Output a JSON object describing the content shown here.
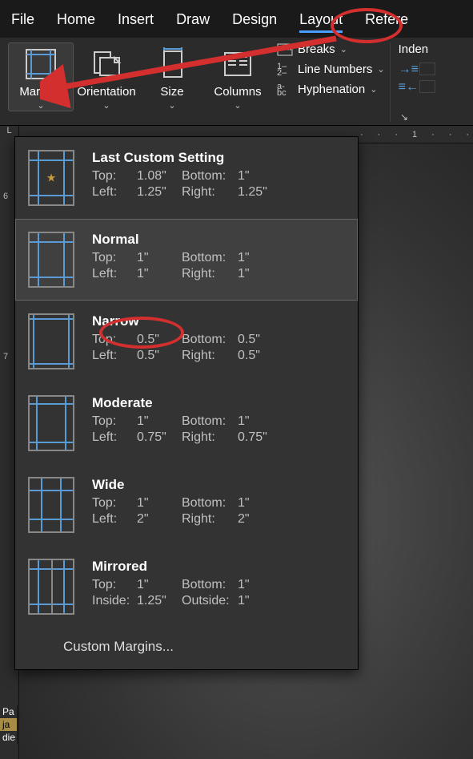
{
  "tabs": {
    "file": "File",
    "home": "Home",
    "insert": "Insert",
    "draw": "Draw",
    "design": "Design",
    "layout": "Layout",
    "references": "Refere"
  },
  "ribbon": {
    "margins": "Margins",
    "orientation": "Orientation",
    "size": "Size",
    "columns": "Columns",
    "breaks": "Breaks",
    "line_numbers": "Line Numbers",
    "hyphenation": "Hyphenation",
    "indent": "Inden"
  },
  "ruler_h": [
    "·",
    "·",
    "·",
    "1",
    "·",
    "·",
    "·"
  ],
  "vruler": {
    "six": "6",
    "seven": "7"
  },
  "leftbar": {
    "l": "L",
    "pa": "Pa",
    "ja": "ja",
    "die": "die"
  },
  "margins_menu": {
    "items": [
      {
        "name": "Last Custom Setting",
        "tl": "Top:",
        "tv": "1.08\"",
        "bl": "Bottom:",
        "bv": "1\"",
        "ll": "Left:",
        "lv": "1.25\"",
        "rl": "Right:",
        "rv": "1.25\"",
        "star": true
      },
      {
        "name": "Normal",
        "tl": "Top:",
        "tv": "1\"",
        "bl": "Bottom:",
        "bv": "1\"",
        "ll": "Left:",
        "lv": "1\"",
        "rl": "Right:",
        "rv": "1\"",
        "hovered": true
      },
      {
        "name": "Narrow",
        "tl": "Top:",
        "tv": "0.5\"",
        "bl": "Bottom:",
        "bv": "0.5\"",
        "ll": "Left:",
        "lv": "0.5\"",
        "rl": "Right:",
        "rv": "0.5\"",
        "circled": true
      },
      {
        "name": "Moderate",
        "tl": "Top:",
        "tv": "1\"",
        "bl": "Bottom:",
        "bv": "1\"",
        "ll": "Left:",
        "lv": "0.75\"",
        "rl": "Right:",
        "rv": "0.75\""
      },
      {
        "name": "Wide",
        "tl": "Top:",
        "tv": "1\"",
        "bl": "Bottom:",
        "bv": "1\"",
        "ll": "Left:",
        "lv": "2\"",
        "rl": "Right:",
        "rv": "2\""
      },
      {
        "name": "Mirrored",
        "tl": "Top:",
        "tv": "1\"",
        "bl": "Bottom:",
        "bv": "1\"",
        "ll": "Inside:",
        "lv": "1.25\"",
        "rl": "Outside:",
        "rv": "1\"",
        "mirrored": true
      }
    ],
    "custom": "Custom Margins..."
  }
}
